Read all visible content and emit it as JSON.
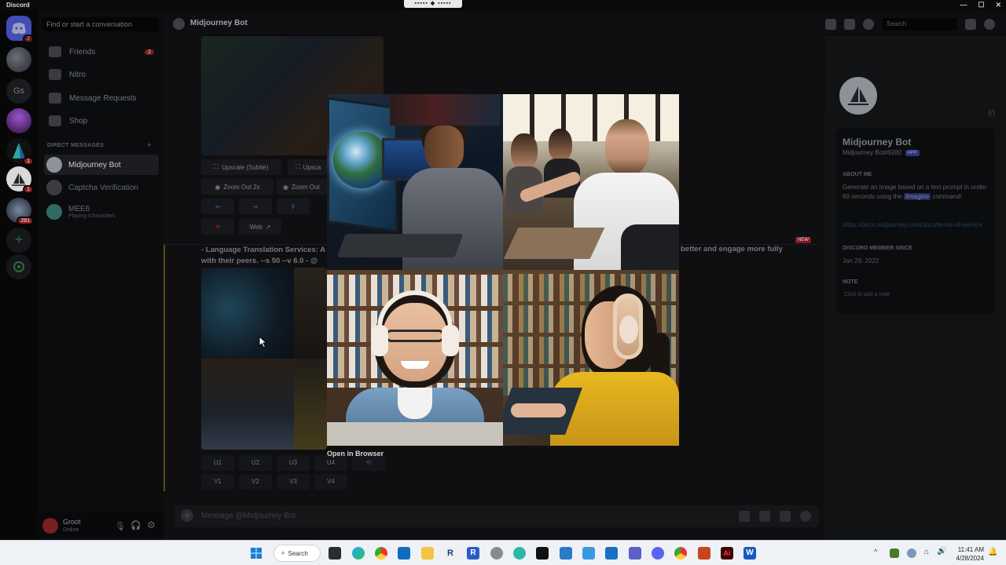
{
  "window": {
    "title": "Discord"
  },
  "dm_sidebar": {
    "search_placeholder": "Find or start a conversation",
    "nav": [
      {
        "label": "Friends",
        "badge": "2"
      },
      {
        "label": "Nitro"
      },
      {
        "label": "Message Requests"
      },
      {
        "label": "Shop"
      }
    ],
    "section_header": "DIRECT MESSAGES",
    "dms": [
      {
        "name": "Midjourney Bot"
      },
      {
        "name": "Captcha Verification"
      },
      {
        "name": "MEE6",
        "status": "Playing /characters"
      }
    ]
  },
  "guild_badges": {
    "first": "2",
    "g5": "1",
    "g6": "1",
    "g7": "281"
  },
  "user": {
    "name": "Groot",
    "status": "Online"
  },
  "channel": {
    "name": "Midjourney Bot",
    "search_placeholder": "Search"
  },
  "message1": {
    "buttons": [
      "Upscale (Subtle)",
      "Upsca",
      "Zoom Out 2x",
      "Zoom Out",
      "Web"
    ]
  },
  "message2": {
    "text_line1": "- Language Translation Services: A",
    "text_line1_right": "better and engage more fully",
    "text_line2": "with their peers. --s 50 --v 6.0 - @",
    "new_tag": "NEW",
    "u_buttons": [
      "U1",
      "U2",
      "U3",
      "U4"
    ],
    "v_buttons": [
      "V1",
      "V2",
      "V3",
      "V4"
    ]
  },
  "lightbox": {
    "open_in_browser": "Open in Browser"
  },
  "composer": {
    "placeholder": "Message @Midjourney Bot"
  },
  "profile": {
    "name": "Midjourney Bot",
    "tag": "Midjourney Bot#9282",
    "app_badge": "APP",
    "about_header": "ABOUT ME",
    "about_pre": "Generate an image based on a text prompt in under 60 seconds using the",
    "about_cmd": "/imagine",
    "about_post": "command!",
    "link": "https://docs.midjourney.com/docs/terms-of-service",
    "member_since_header": "DISCORD MEMBER SINCE",
    "member_since": "Jan 29, 2022",
    "note_header": "NOTE",
    "note_placeholder": "Click to add a note"
  },
  "taskbar": {
    "search_label": "Search",
    "time": "11:41 AM",
    "date": "4/28/2024"
  },
  "colors": {
    "accent": "#5865f2",
    "background": "#0f0f11",
    "badge": "#7c1b1f"
  }
}
